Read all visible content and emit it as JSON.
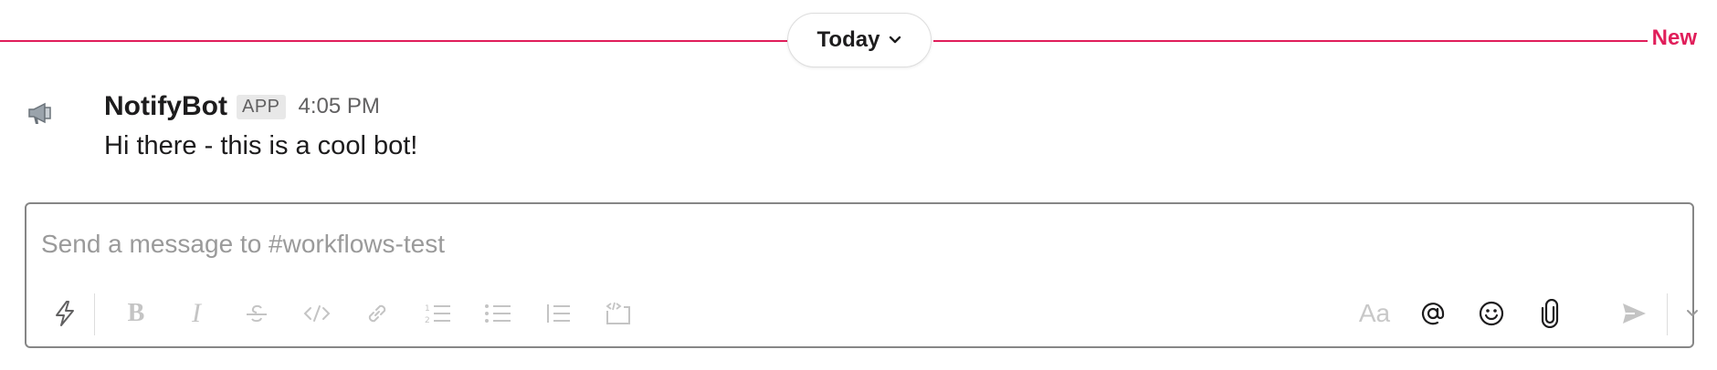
{
  "divider": {
    "day_label": "Today",
    "new_label": "New",
    "accent_color": "#e01e5a"
  },
  "message": {
    "avatar_icon": "megaphone-icon",
    "sender": "NotifyBot",
    "badge": "APP",
    "time": "4:05 PM",
    "text": "Hi there - this is a cool bot!"
  },
  "composer": {
    "placeholder": "Send a message to #workflows-test",
    "value": "",
    "toolbar": {
      "shortcuts_icon": "lightning-icon",
      "bold_label": "B",
      "italic_label": "I",
      "formatting_label": "Aa",
      "icons": [
        "strikethrough-icon",
        "code-icon",
        "link-icon",
        "ordered-list-icon",
        "bulleted-list-icon",
        "blockquote-icon",
        "code-block-icon",
        "mention-icon",
        "emoji-icon",
        "attachment-icon",
        "send-icon",
        "send-options-chevron-icon"
      ]
    }
  }
}
